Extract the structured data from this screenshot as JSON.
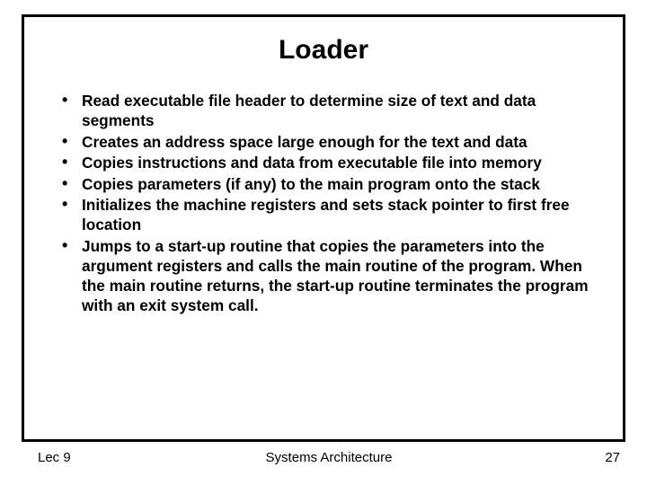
{
  "slide": {
    "title": "Loader",
    "bullets": [
      "Read executable file header to determine size of text and data segments",
      "Creates an address space large enough for the text and data",
      "Copies instructions and data from executable file into memory",
      "Copies parameters (if any) to the main program onto the stack",
      "Initializes the machine registers and sets stack pointer to first free location",
      "Jumps to a start-up routine that copies the parameters into the argument registers and calls the main routine of the program.  When the main routine returns, the start-up routine terminates the program with an exit system call."
    ],
    "footer": {
      "left": "Lec 9",
      "center": "Systems Architecture",
      "right": "27"
    }
  }
}
